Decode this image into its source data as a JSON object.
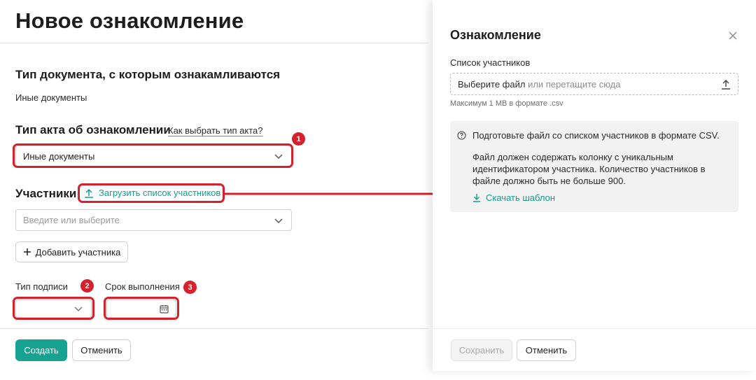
{
  "form": {
    "page_title": "Новое ознакомление",
    "doc_type_heading": "Тип документа, с которым ознакамливаются",
    "doc_type_value": "Иные документы",
    "act_type_heading": "Тип акта об ознакомлении",
    "act_type_help_link": "Как выбрать тип акта?",
    "act_type_select_value": "Иные документы",
    "participants_heading": "Участники",
    "upload_list_link": "Загрузить список участников",
    "participants_placeholder": "Введите или выберите",
    "add_participant_button": "Добавить участника",
    "signature_type_label": "Тип подписи",
    "signature_type_value": "",
    "deadline_label": "Срок выполнения",
    "deadline_value": "",
    "create_button": "Создать",
    "cancel_button": "Отменить"
  },
  "panel": {
    "title": "Ознакомление",
    "participants_list_label": "Список участников",
    "file_choose_text": "Выберите файл",
    "file_drag_text": " или перетащите сюда",
    "file_hint": "Максимум 1 MB в формате .csv",
    "info_line1": "Подготовьте файл со списком участников в формате CSV.",
    "info_line2": "Файл должен содержать колонку с уникальным идентификатором участника. Количество участников в файле должно быть не больше 900.",
    "download_template_link": "Скачать шаблон",
    "save_button": "Сохранить",
    "cancel_button": "Отменить"
  },
  "annotations": {
    "badge_1": "1",
    "badge_2": "2",
    "badge_3": "3"
  },
  "colors": {
    "accent": "#16a392",
    "annotation_red": "#d4212a",
    "link_green": "#139d8c"
  },
  "icons": [
    "upload-icon",
    "chevron-down-icon",
    "plus-icon",
    "calendar-icon",
    "close-icon",
    "question-circle-icon",
    "download-icon",
    "arrow-right-icon"
  ]
}
